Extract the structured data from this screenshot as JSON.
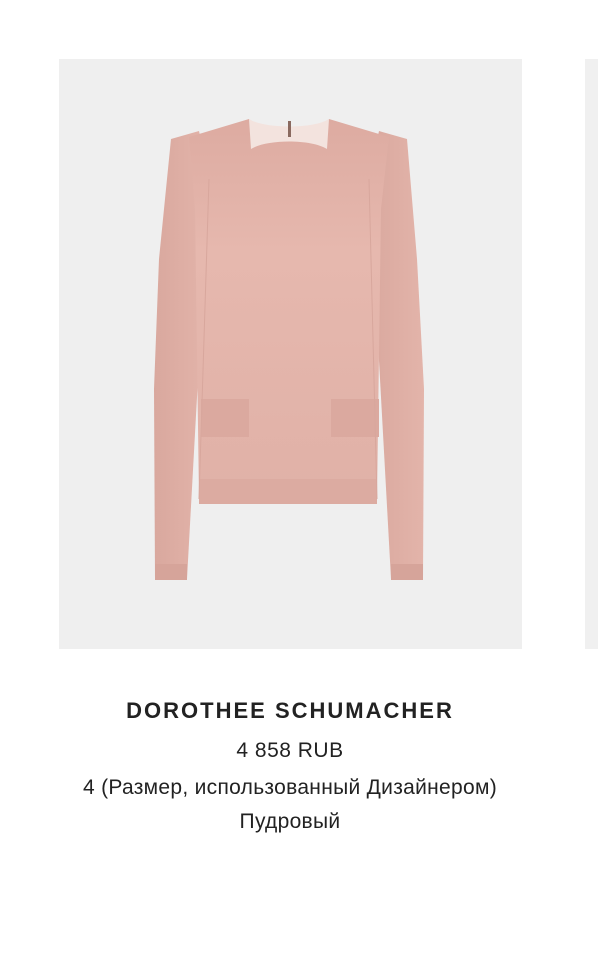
{
  "product": {
    "image_alt": "Пудровый джемпер с длинными рукавами",
    "brand": "DOROTHEE SCHUMACHER",
    "price": "4 858 RUB",
    "size": "4 (Размер, использованный Дизайнером)",
    "color": "Пудровый"
  },
  "colors": {
    "image_background": "#efefef",
    "garment": "#e2b3aa",
    "text": "#222222"
  }
}
